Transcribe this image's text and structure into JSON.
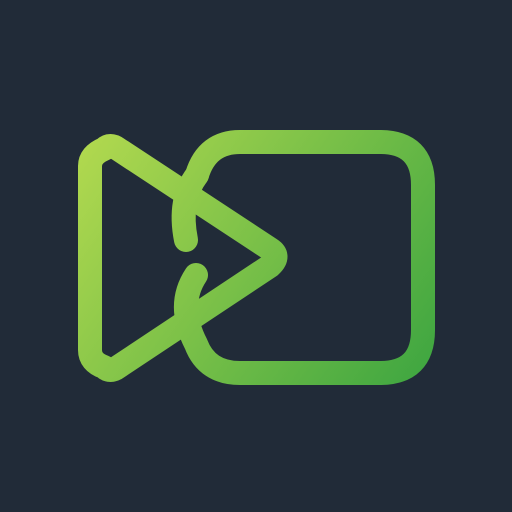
{
  "icon": {
    "name": "video-play-logo-icon",
    "background_color": "#212b38",
    "gradient_start_color": "#b2d94f",
    "gradient_end_color": "#3aa440"
  }
}
